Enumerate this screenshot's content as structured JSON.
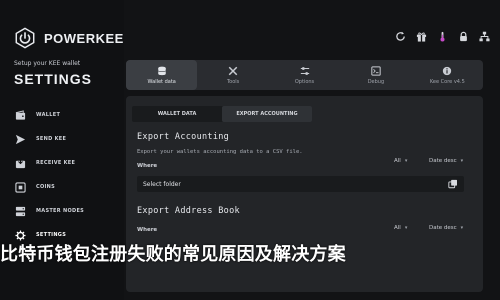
{
  "brand": {
    "name": "POWERKEE",
    "logo_icon": "power-icon"
  },
  "sidebar": {
    "subtitle": "Setup your KEE wallet",
    "title": "SETTINGS",
    "items": [
      {
        "label": "WALLET",
        "icon": "wallet-icon"
      },
      {
        "label": "SEND KEE",
        "icon": "send-icon"
      },
      {
        "label": "RECEIVE KEE",
        "icon": "receive-icon"
      },
      {
        "label": "COINS",
        "icon": "coins-icon"
      },
      {
        "label": "MASTER NODES",
        "icon": "server-icon"
      },
      {
        "label": "SETTINGS",
        "icon": "gear-icon",
        "active": true
      }
    ]
  },
  "toolbar": {
    "icons": [
      "refresh-icon",
      "gift-icon",
      "thermometer-icon",
      "lock-icon",
      "network-icon"
    ]
  },
  "tabs": [
    {
      "label": "Wallet data",
      "icon": "database-icon",
      "active": true
    },
    {
      "label": "Tools",
      "icon": "tools-icon"
    },
    {
      "label": "Options",
      "icon": "sliders-icon"
    },
    {
      "label": "Debug",
      "icon": "bug-icon"
    },
    {
      "label": "Kee Core v4.5",
      "icon": "info-icon"
    }
  ],
  "subtabs": [
    {
      "label": "WALLET DATA"
    },
    {
      "label": "EXPORT ACCOUNTING",
      "active": true
    }
  ],
  "export_accounting": {
    "title": "Export Accounting",
    "description": "Export your wallets accounting data to a CSV file.",
    "where_label": "Where",
    "filter": "All",
    "sort": "Date desc",
    "folder_placeholder": "Select folder"
  },
  "export_address_book": {
    "title": "Export Address Book",
    "where_label": "Where",
    "filter": "All",
    "sort": "Date desc"
  },
  "overlay_title": "比特币钱包注册失败的常见原因及解决方案"
}
